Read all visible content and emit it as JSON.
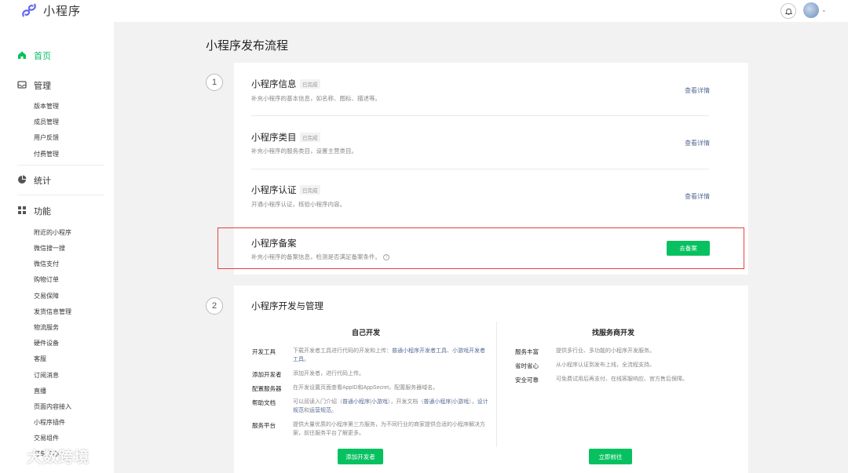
{
  "app": {
    "title": "小程序"
  },
  "sidebar": {
    "home": "首页",
    "manage": {
      "label": "管理",
      "items": [
        "版本管理",
        "成员管理",
        "用户反馈",
        "付费管理"
      ]
    },
    "stats": "统计",
    "features": {
      "label": "功能",
      "items": [
        "附近的小程序",
        "微信搜一搜",
        "微信支付",
        "购物订单",
        "交易保障",
        "发货信息管理",
        "物流服务",
        "硬件设备",
        "客服",
        "订阅消息",
        "直播",
        "页面内容接入",
        "小程序插件",
        "交易组件",
        "订单中心"
      ]
    }
  },
  "main": {
    "title": "小程序发布流程",
    "step1": "1",
    "step2": "2",
    "items": [
      {
        "title": "小程序信息",
        "badge": "已完成",
        "desc": "补充小程序的基本信息，如名称、图标、描述等。",
        "link": "查看详情"
      },
      {
        "title": "小程序类目",
        "badge": "已完成",
        "desc": "补充小程序的服务类目，设置主营类目。",
        "link": "查看详情"
      },
      {
        "title": "小程序认证",
        "badge": "已完成",
        "desc": "开通小程序认证，核验小程序内容。",
        "link": "查看详情"
      },
      {
        "title": "小程序备案",
        "desc": "补充小程序的备案信息，检测是否满足备案条件。",
        "button": "去备案"
      }
    ],
    "dev": {
      "title": "小程序开发与管理",
      "self": {
        "title": "自己开发",
        "rows": [
          {
            "label": "开发工具",
            "text1": "下载开发者工具进行代码的开发和上传：",
            "link1": "普通小程序开发者工具",
            "sep1": "、",
            "link2": "小游戏开发者工具",
            "end": "。"
          },
          {
            "label": "添加开发者",
            "text": "添加开发者，进行代码上传。"
          },
          {
            "label": "配置服务器",
            "text": "在开发设置页面查看AppID和AppSecret，配置服务器域名。"
          },
          {
            "label": "帮助文档",
            "t1": "可以阅读入门介绍（",
            "l1": "普通小程序",
            "t2": "|",
            "l2": "小游戏",
            "t3": "），开发文档（",
            "l3": "普通小程序",
            "t4": "|",
            "l4": "小游戏",
            "t5": "），",
            "l5": "设计规范",
            "t6": "和",
            "l6": "运营规范",
            "t7": "。"
          },
          {
            "label": "服务平台",
            "text": "提供大量优质的小程序第三方服务，为不同行业的商家提供合适的小程序解决方案，前往服务平台了解更多。"
          }
        ],
        "button": "添加开发者"
      },
      "provider": {
        "title": "找服务商开发",
        "rows": [
          {
            "label": "服务丰富",
            "text": "提供多行业、多功能的小程序开发服务。"
          },
          {
            "label": "省时省心",
            "text": "从小程序认证到发布上线，全流程支持。"
          },
          {
            "label": "安全可靠",
            "text": "可免费试用后再支付、在线客服响应、官方售后保障。"
          }
        ],
        "button": "立即前往"
      }
    }
  },
  "watermark": "大数跨境",
  "colors": {
    "accent": "#07c160",
    "link": "#576b95",
    "highlight": "#e84040"
  }
}
